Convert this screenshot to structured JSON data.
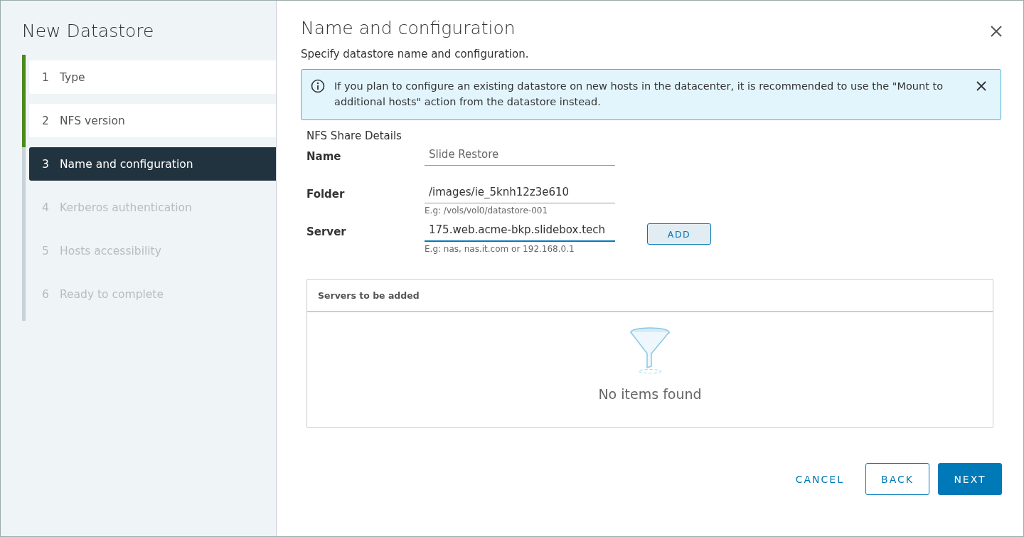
{
  "sidebar": {
    "title": "New Datastore",
    "steps": [
      {
        "number": "1",
        "label": "Type",
        "completed": true,
        "selected": false,
        "disabled": false
      },
      {
        "number": "2",
        "label": "NFS version",
        "completed": true,
        "selected": false,
        "disabled": false
      },
      {
        "number": "3",
        "label": "Name and configuration",
        "completed": false,
        "selected": true,
        "disabled": false
      },
      {
        "number": "4",
        "label": "Kerberos authentication",
        "completed": false,
        "selected": false,
        "disabled": true
      },
      {
        "number": "5",
        "label": "Hosts accessibility",
        "completed": false,
        "selected": false,
        "disabled": true
      },
      {
        "number": "6",
        "label": "Ready to complete",
        "completed": false,
        "selected": false,
        "disabled": true
      }
    ]
  },
  "page": {
    "title": "Name and configuration",
    "subtitle": "Specify datastore name and configuration."
  },
  "alert": {
    "text": "If you plan to configure an existing datastore on new hosts in the datacenter, it is recommended to use the \"Mount to additional hosts\" action from the datastore instead."
  },
  "form": {
    "section": "NFS Share Details",
    "fields": [
      {
        "label": "Name",
        "value": "Slide Restore",
        "focused": false,
        "muted": true
      },
      {
        "label": "Folder",
        "value": "/images/ie_5knh12z3e610",
        "hint": "E.g: /vols/vol0/datastore-001",
        "focused": false,
        "muted": false
      },
      {
        "label": "Server",
        "value": "175.web.acme-bkp.slidebox.tech",
        "hint": "E.g: nas, nas.it.com or 192.168.0.1",
        "focused": true,
        "muted": false,
        "button": "ADD"
      }
    ]
  },
  "servers_table": {
    "header": "Servers to be added",
    "empty_text": "No items found"
  },
  "footer": {
    "buttons": [
      {
        "label": "CANCEL",
        "kind": "flat"
      },
      {
        "label": "BACK",
        "kind": "outline"
      },
      {
        "label": "NEXT",
        "kind": "primary"
      }
    ]
  }
}
